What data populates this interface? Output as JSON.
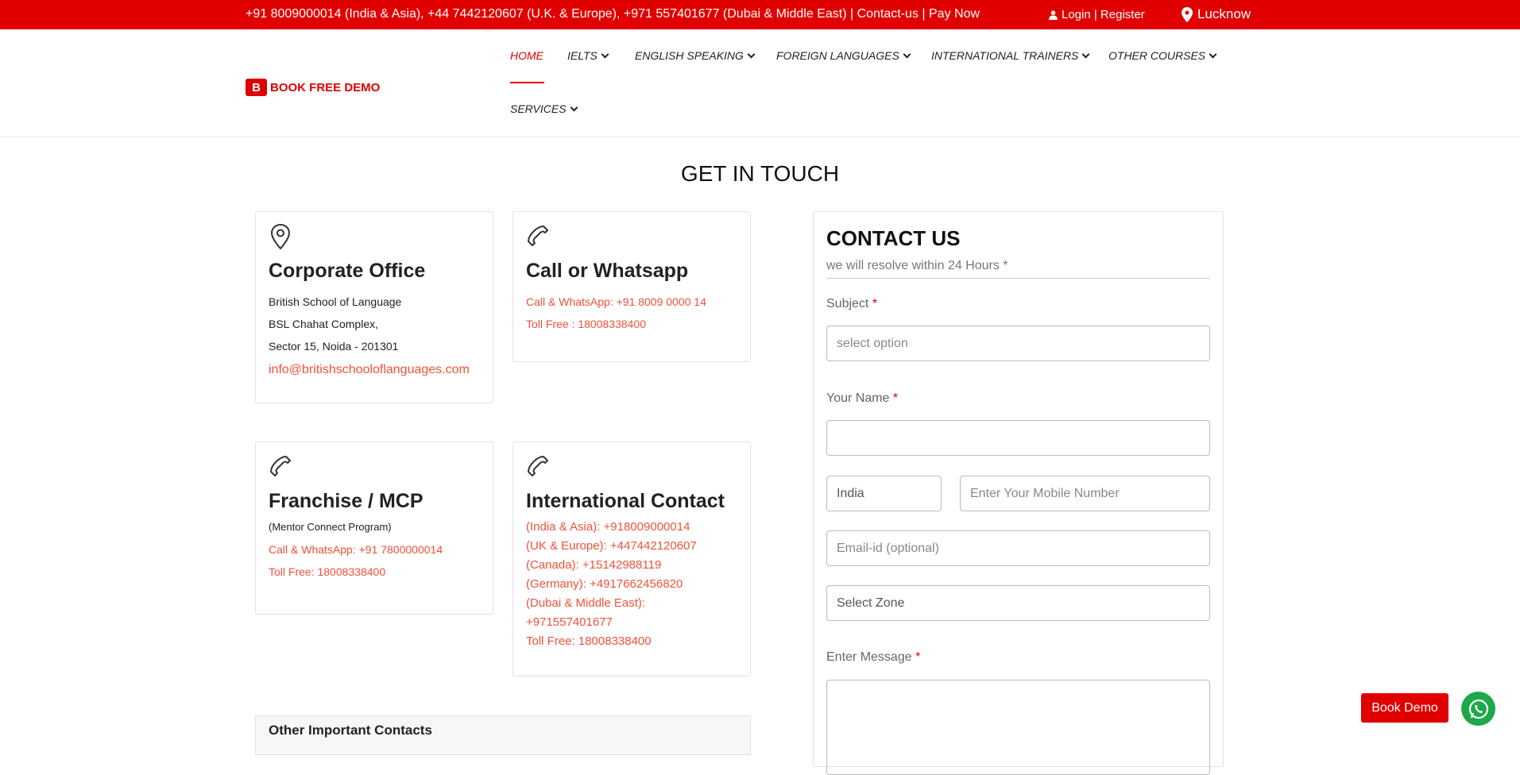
{
  "topbar": {
    "phones": "+91 8009000014 (India & Asia), +44 7442120607 (U.K. & Europe), +971 557401677 (Dubai & Middle East) | Contact-us | Pay Now",
    "login": "Login | Register",
    "city": "Lucknow"
  },
  "logo": {
    "text": "BOOK FREE DEMO",
    "mark": "B"
  },
  "nav": {
    "home": "HOME",
    "ielts": "IELTS",
    "english": "ENGLISH SPEAKING",
    "foreign": "FOREIGN LANGUAGES",
    "trainers": "INTERNATIONAL TRAINERS",
    "other": "OTHER COURSES",
    "services": "SERVICES"
  },
  "page_title": "GET IN TOUCH",
  "cards": {
    "corporate": {
      "title": "Corporate Office",
      "line1": "British School of Language",
      "line2": "BSL Chahat Complex,",
      "line3": "Sector 15, Noida - 201301",
      "email": "info@britishschooloflanguages.com"
    },
    "call": {
      "title": "Call or Whatsapp",
      "line1": "Call & WhatsApp: +91 8009 0000 14",
      "line2": "Toll Free : 18008338400"
    },
    "franchise": {
      "title": "Franchise / MCP",
      "sub": "(Mentor Connect Program)",
      "line1": "Call & WhatsApp: +91 7800000014",
      "line2": "Toll Free: 18008338400"
    },
    "international": {
      "title": "International Contact",
      "l1": "(India & Asia): +918009000014",
      "l2": "(UK & Europe): +447442120607",
      "l3": "(Canada): +15142988119",
      "l4": "(Germany): +4917662456820",
      "l5": "(Dubai & Middle East):",
      "l6": "+971557401677",
      "l7": "Toll Free: 18008338400"
    }
  },
  "others_title": "Other Important Contacts",
  "form": {
    "title": "CONTACT US",
    "subtitle": "we will resolve within 24 Hours *",
    "subject_label": "Subject",
    "subject_value": "select option",
    "name_label": "Your Name",
    "name_value": "",
    "country_value": "India",
    "mobile_placeholder": "Enter Your Mobile Number",
    "email_placeholder": "Email-id (optional)",
    "zone_value": "Select Zone",
    "message_label": "Enter Message",
    "required_mark": "*"
  },
  "floating": {
    "book_demo": "Book Demo"
  },
  "colors": {
    "brand_red": "#e00000",
    "link_red": "#f0513a",
    "whatsapp_green": "#1ea84a"
  }
}
